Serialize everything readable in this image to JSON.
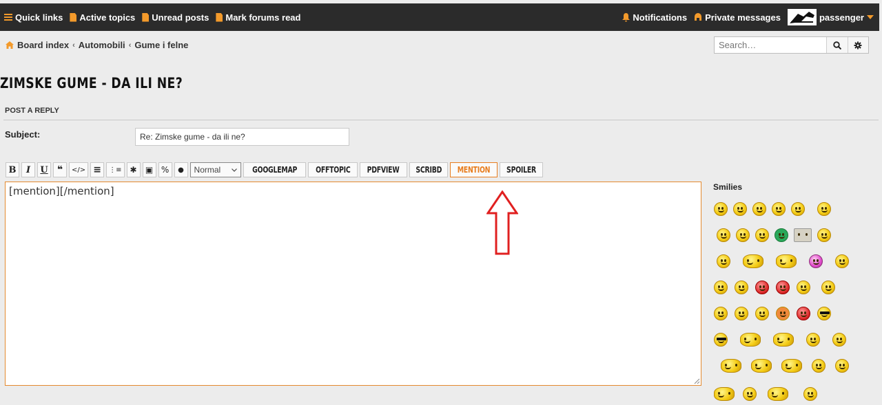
{
  "navbar": {
    "quick_links": "Quick links",
    "active_topics": "Active topics",
    "unread_posts": "Unread posts",
    "mark_read": "Mark forums read",
    "notifications": "Notifications",
    "private_messages": "Private messages",
    "username": "passenger"
  },
  "breadcrumbs": [
    "Board index",
    "Automobili",
    "Gume i felne"
  ],
  "search": {
    "placeholder": "Search…"
  },
  "topic_title": "ZIMSKE GUME - DA ILI NE?",
  "section": "POST A REPLY",
  "subject": {
    "label": "Subject:",
    "value": "Re: Zimske gume - da ili ne?"
  },
  "toolbar": {
    "bold": "B",
    "italic": "I",
    "underline": "U",
    "quote": "❝",
    "code": "</>",
    "list": "≡",
    "list_numbered": "⋮≡",
    "list_item": "✱",
    "image": "▣",
    "link": "%",
    "color": "●",
    "font_size": "Normal",
    "googlemap": "GOOGLEMAP",
    "offtopic": "OFFTOPIC",
    "pdfview": "PDFVIEW",
    "scribd": "SCRIBD",
    "mention": "MENTION",
    "spoiler": "SPOILER"
  },
  "editor": {
    "value": "[mention][/mention]"
  },
  "smilies": {
    "title": "Smilies"
  },
  "colors": {
    "accent": "#f39a2b",
    "arrow": "#e02020",
    "navbar": "#2b2b2b"
  }
}
